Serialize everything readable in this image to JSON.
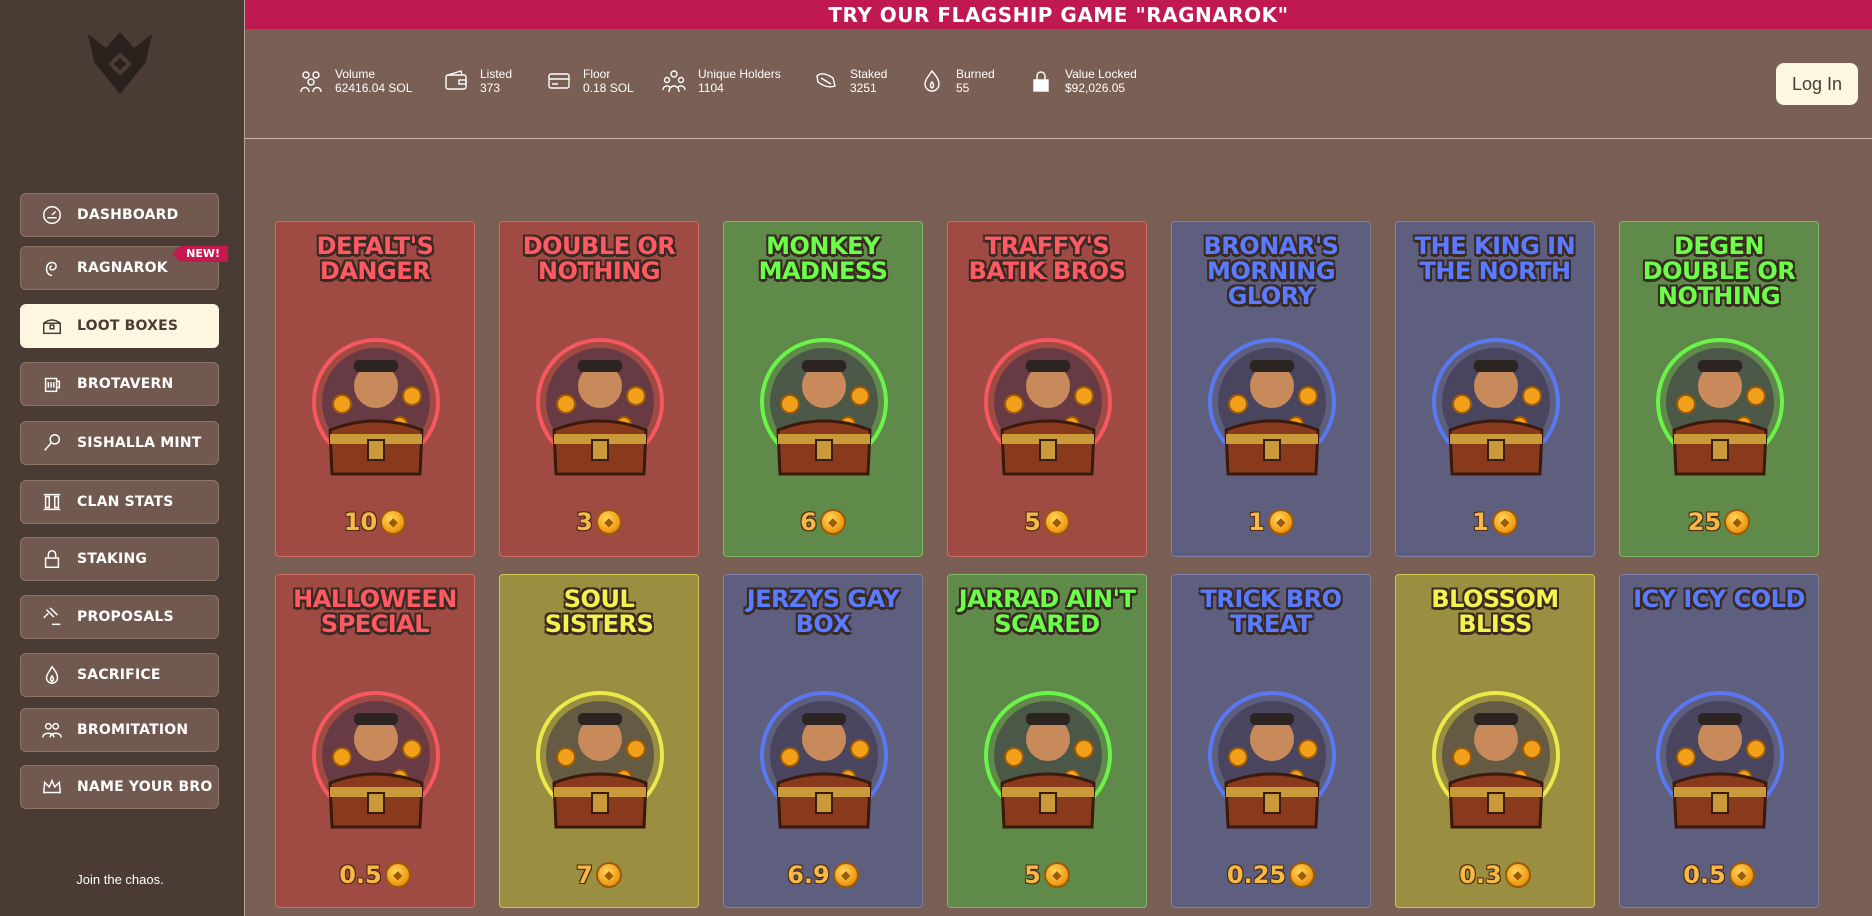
{
  "banner": {
    "text": "TRY OUR FLAGSHIP GAME \"RAGNAROK\""
  },
  "sidebar": {
    "items": [
      {
        "label": "DASHBOARD",
        "icon": "gauge-icon"
      },
      {
        "label": "RAGNAROK",
        "icon": "swirl-icon",
        "badge": "NEW!"
      },
      {
        "label": "LOOT BOXES",
        "icon": "chest-icon",
        "active": true
      },
      {
        "label": "BROTAVERN",
        "icon": "tavern-icon"
      },
      {
        "label": "SISHALLA MINT",
        "icon": "wand-icon"
      },
      {
        "label": "CLAN STATS",
        "icon": "pillars-icon"
      },
      {
        "label": "STAKING",
        "icon": "lock-icon"
      },
      {
        "label": "PROPOSALS",
        "icon": "gavel-icon"
      },
      {
        "label": "SACRIFICE",
        "icon": "flame-icon"
      },
      {
        "label": "BROMITATION",
        "icon": "group-icon"
      },
      {
        "label": "NAME YOUR BRO",
        "icon": "crown-icon"
      }
    ],
    "footer": "Join the chaos."
  },
  "stats": [
    {
      "label": "Volume",
      "value": "62416.04 SOL",
      "icon": "group-icon"
    },
    {
      "label": "Listed",
      "value": "373",
      "icon": "wallet-icon"
    },
    {
      "label": "Floor",
      "value": "0.18 SOL",
      "icon": "card-icon"
    },
    {
      "label": "Unique Holders",
      "value": "1104",
      "icon": "holders-icon"
    },
    {
      "label": "Staked",
      "value": "3251",
      "icon": "stake-icon"
    },
    {
      "label": "Burned",
      "value": "55",
      "icon": "flame-icon"
    },
    {
      "label": "Value Locked",
      "value": "$92,026.05",
      "icon": "padlock-icon"
    }
  ],
  "header": {
    "login_label": "Log In"
  },
  "loot_boxes": [
    {
      "title": "DEFALT'S DANGER",
      "price": "10",
      "theme": "red"
    },
    {
      "title": "DOUBLE OR NOTHING",
      "price": "3",
      "theme": "red"
    },
    {
      "title": "MONKEY MADNESS",
      "price": "6",
      "theme": "green"
    },
    {
      "title": "TRAFFY'S BATIK BROS",
      "price": "5",
      "theme": "red"
    },
    {
      "title": "BRONAR'S MORNING GLORY",
      "price": "1",
      "theme": "blue"
    },
    {
      "title": "THE KING IN THE NORTH",
      "price": "1",
      "theme": "blue"
    },
    {
      "title": "DEGEN DOUBLE OR NOTHING",
      "price": "25",
      "theme": "green"
    },
    {
      "title": "HALLOWEEN SPECIAL",
      "price": "0.5",
      "theme": "red"
    },
    {
      "title": "SOUL SISTERS",
      "price": "7",
      "theme": "yellow"
    },
    {
      "title": "JERZYS GAY BOX",
      "price": "6.9",
      "theme": "blue"
    },
    {
      "title": "JARRAD AIN'T SCARED",
      "price": "5",
      "theme": "green"
    },
    {
      "title": "TRICK BRO TREAT",
      "price": "0.25",
      "theme": "blue"
    },
    {
      "title": "BLOSSOM BLISS",
      "price": "0.3",
      "theme": "yellow"
    },
    {
      "title": "ICY ICY COLD",
      "price": "0.5",
      "theme": "blue"
    }
  ]
}
